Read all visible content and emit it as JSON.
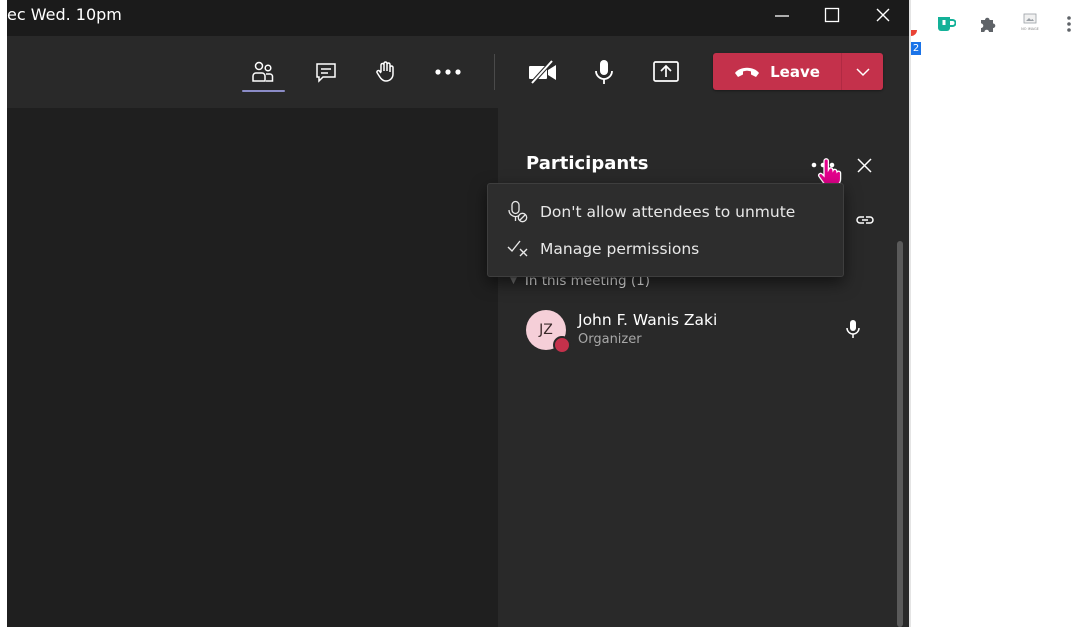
{
  "window": {
    "title": "ec Wed. 10pm",
    "controls": [
      "minimize",
      "maximize",
      "close"
    ]
  },
  "toolbar": {
    "items": [
      "people-icon",
      "chat-icon",
      "raise-hand-icon",
      "more-icon",
      "camera-off-icon",
      "mic-icon",
      "share-icon"
    ],
    "leave_label": "Leave",
    "leave_color": "#c4314b"
  },
  "panel": {
    "title": "Participants",
    "section_header": "In this meeting (1)",
    "participants": [
      {
        "initials": "JZ",
        "name": "John F. Wanis Zaki",
        "role": "Organizer"
      }
    ]
  },
  "menu": {
    "items": [
      {
        "icon": "mic-off-icon",
        "label": "Don't allow attendees to unmute"
      },
      {
        "icon": "manage-permissions-icon",
        "label": "Manage permissions"
      }
    ]
  },
  "chrome": {
    "badge_count": "2",
    "noimage_text": "NO IMAGE",
    "extensions": [
      "badge-icon",
      "cup-icon",
      "puzzle-icon",
      "no-image-icon",
      "kebab-icon"
    ]
  },
  "colors": {
    "accent": "#8b8cc7",
    "leave": "#c4314b",
    "panel_bg": "#292929",
    "stage_bg": "#1f1f1f"
  }
}
